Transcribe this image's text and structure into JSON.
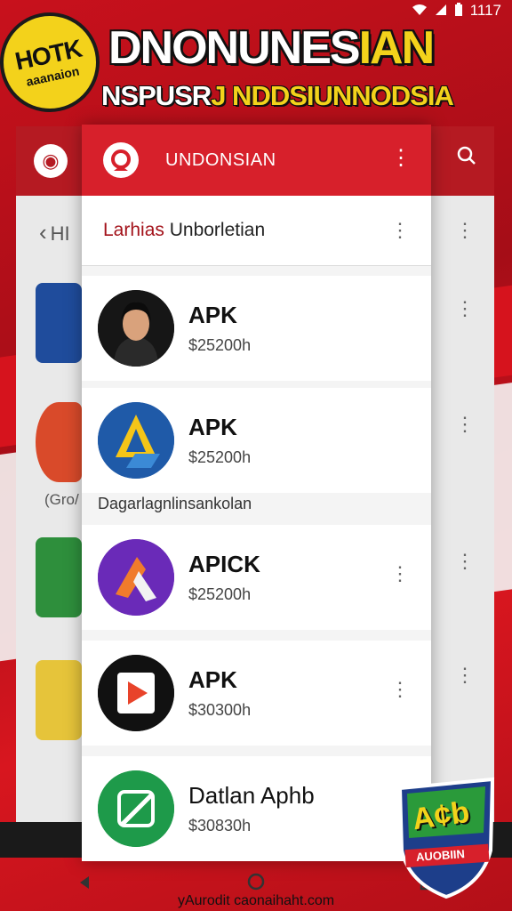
{
  "status_bar": {
    "time": "1117"
  },
  "header": {
    "badge_line1": "HOTK",
    "badge_line2": "aaanaion",
    "title_main": "DNONUNES",
    "title_accent": "IAN",
    "subtitle_main": "NSPUSR",
    "subtitle_accent": "J NDDSIUNNODSIA"
  },
  "background_window": {
    "back_label": "HI",
    "caption": "(Gro/"
  },
  "panel": {
    "app_title": "UNDONSIAN",
    "section_title_red": "Larhias",
    "section_title_rest": " Unborletian",
    "section_caption": "Dagarlagnlinsankolan",
    "apps": [
      {
        "name": "APK",
        "price": "$25200h"
      },
      {
        "name": "APK",
        "price": "$25200h"
      },
      {
        "name": "APICK",
        "price": "$25200h"
      },
      {
        "name": "APK",
        "price": "$30300h"
      },
      {
        "name": "Datlan Aphb",
        "price": "$30830h"
      }
    ]
  },
  "shield": {
    "line1": "A¢b",
    "line2": "AUOBIIN"
  },
  "footer": {
    "website": "yAurodit caonaihaht.com"
  },
  "colors": {
    "brand_red": "#d7202b",
    "accent_yellow": "#f3d21b"
  }
}
